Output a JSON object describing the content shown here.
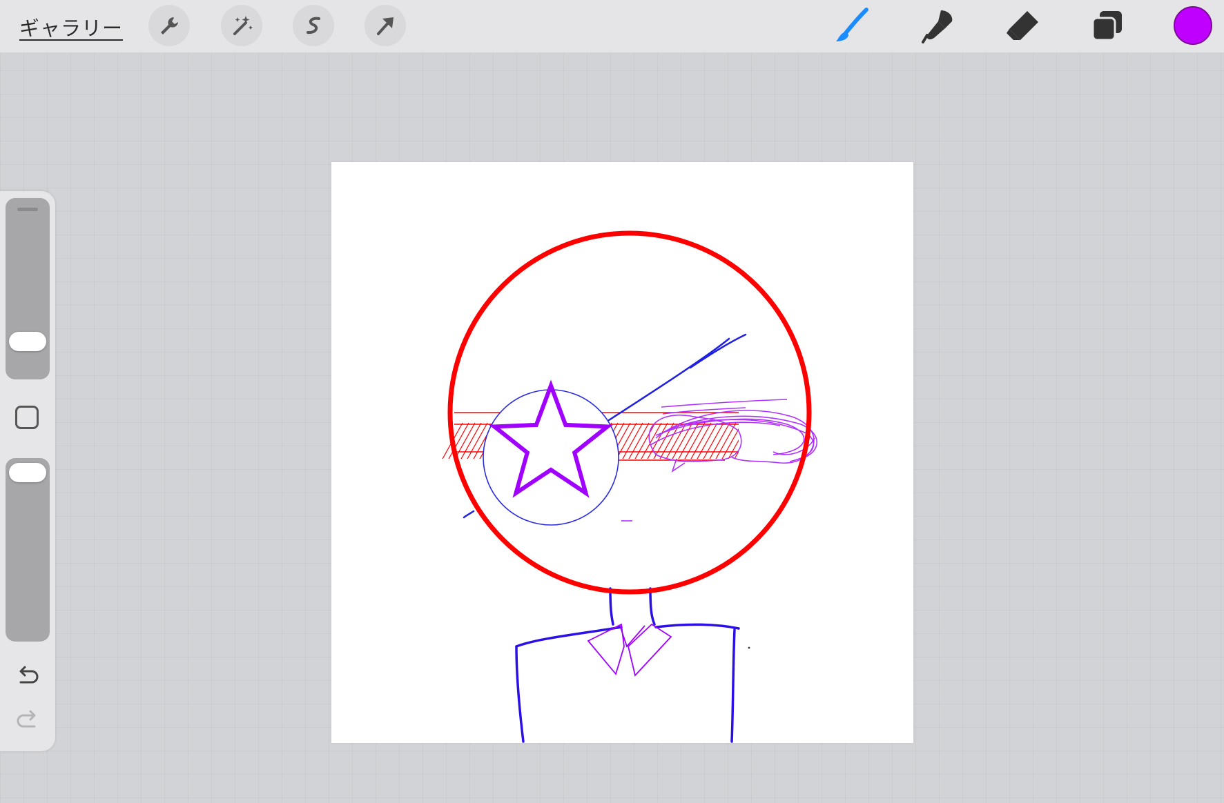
{
  "toolbar": {
    "gallery_label": "ギャラリー",
    "left_tools": [
      "wrench-icon",
      "magic-wand-icon",
      "selection-s-icon",
      "transform-arrow-icon"
    ],
    "right_tools": [
      "brush-icon",
      "smudge-icon",
      "eraser-icon",
      "layers-icon"
    ],
    "active_tool": "brush-icon",
    "current_color": "#c000ff",
    "accent_color": "#1a8cff"
  },
  "sidebar": {
    "brush_size_icon": "slider-handle",
    "modify_button_icon": "square-icon",
    "undo_icon": "undo-arrow-icon",
    "redo_icon": "redo-arrow-icon",
    "redo_enabled": false
  },
  "drawing": {
    "stroke_colors": {
      "outline": "#ff0000",
      "blue": "#2020e0",
      "purple": "#a000ff"
    }
  }
}
